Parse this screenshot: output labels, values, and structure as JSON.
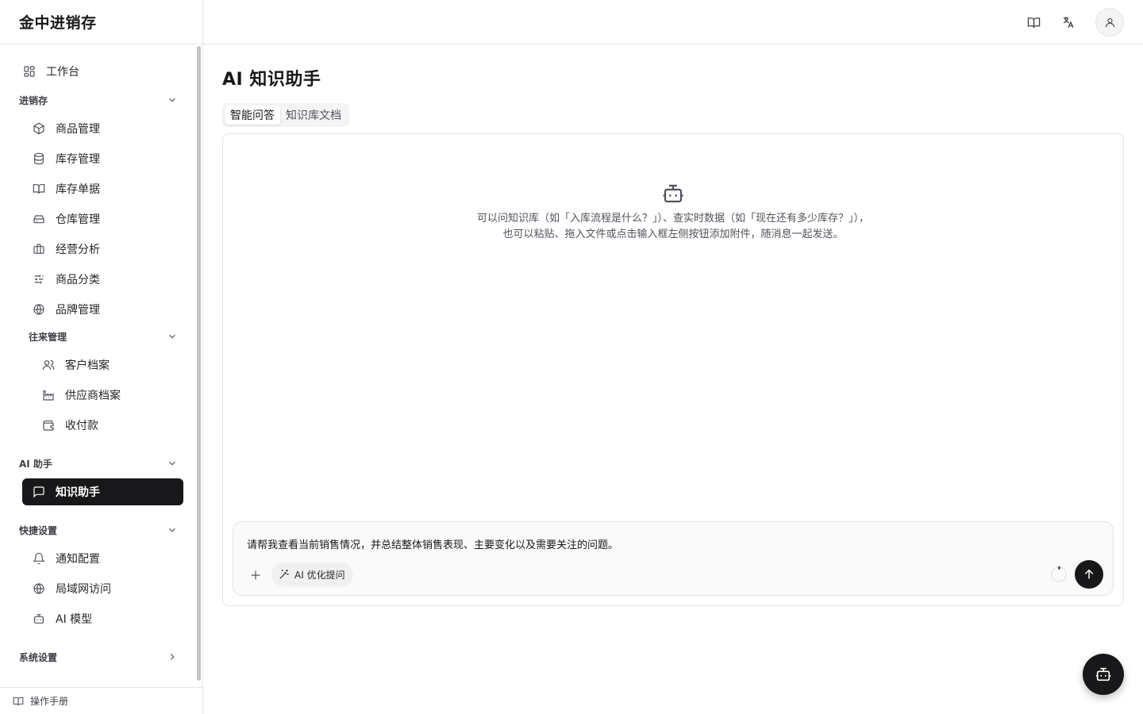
{
  "app": {
    "title": "金中进销存"
  },
  "sidebar": {
    "workbench": "工作台",
    "groups": {
      "inventory": {
        "label": "进销存",
        "items": [
          "商品管理",
          "库存管理",
          "库存单据",
          "仓库管理",
          "经营分析",
          "商品分类",
          "品牌管理"
        ],
        "sub_group": {
          "label": "往来管理",
          "items": [
            "客户档案",
            "供应商档案",
            "收付款"
          ]
        }
      },
      "ai": {
        "label": "AI 助手",
        "items": [
          "知识助手"
        ]
      },
      "quick": {
        "label": "快捷设置",
        "items": [
          "通知配置",
          "局域网访问",
          "AI 模型"
        ]
      },
      "system": {
        "label": "系统设置"
      }
    },
    "manual": "操作手册"
  },
  "page": {
    "title": "AI 知识助手",
    "tabs": [
      {
        "label": "智能问答",
        "active": true
      },
      {
        "label": "知识库文档",
        "active": false
      }
    ]
  },
  "chat": {
    "empty_line1": "可以问知识库（如「入库流程是什么？」）、查实时数据（如「现在还有多少库存？」），",
    "empty_line2": "也可以粘贴、拖入文件或点击输入框左侧按钮添加附件，随消息一起发送。",
    "input_value": "请帮我查看当前销售情况，并总结整体销售表现、主要变化以及需要关注的问题。",
    "optimize_label": "AI 优化提问"
  },
  "colors": {
    "accent": "#18181b",
    "border": "#e4e4e7",
    "muted_text": "#52525b",
    "tab_track": "#f4f4f5"
  },
  "icons": {
    "header": [
      "book-open-icon",
      "languages-icon",
      "user-icon"
    ],
    "sidebar": [
      "layout-grid-icon",
      "package-icon",
      "database-icon",
      "book-icon",
      "warehouse-icon",
      "briefcase-icon",
      "sliders-icon",
      "globe-icon",
      "users-icon",
      "factory-icon",
      "wallet-icon",
      "message-square-icon",
      "bell-icon",
      "globe-icon",
      "bot-icon"
    ],
    "chat": [
      "bot-icon",
      "plus-icon",
      "wand-icon",
      "arrow-up-icon"
    ]
  }
}
